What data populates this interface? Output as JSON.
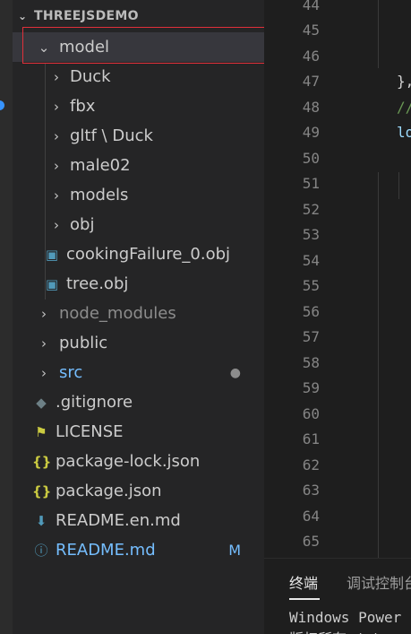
{
  "explorer": {
    "section_title": "THREEJSDEMO",
    "items": [
      {
        "label": "model",
        "kind": "folder",
        "expanded": true,
        "depth": 0
      },
      {
        "label": "Duck",
        "kind": "folder",
        "depth": 1
      },
      {
        "label": "fbx",
        "kind": "folder",
        "depth": 1
      },
      {
        "label": "gltf \\ Duck",
        "kind": "folder",
        "depth": 1
      },
      {
        "label": "male02",
        "kind": "folder",
        "depth": 1
      },
      {
        "label": "models",
        "kind": "folder",
        "depth": 1
      },
      {
        "label": "obj",
        "kind": "folder",
        "depth": 1
      },
      {
        "label": "cookingFailure_0.obj",
        "kind": "file",
        "icon": "obj-file-icon",
        "depth": 1
      },
      {
        "label": "tree.obj",
        "kind": "file",
        "icon": "obj-file-icon",
        "depth": 1
      },
      {
        "label": "node_modules",
        "kind": "folder",
        "depth": 0,
        "dimmed": true
      },
      {
        "label": "public",
        "kind": "folder",
        "depth": 0
      },
      {
        "label": "src",
        "kind": "folder",
        "depth": 0,
        "modified_dot": true
      },
      {
        "label": ".gitignore",
        "kind": "file",
        "icon": "git-icon",
        "depth": 0
      },
      {
        "label": "LICENSE",
        "kind": "file",
        "icon": "license-icon",
        "depth": 0
      },
      {
        "label": "package-lock.json",
        "kind": "file",
        "icon": "json-icon",
        "depth": 0
      },
      {
        "label": "package.json",
        "kind": "file",
        "icon": "json-icon",
        "depth": 0
      },
      {
        "label": "README.en.md",
        "kind": "file",
        "icon": "markdown-icon",
        "depth": 0
      },
      {
        "label": "README.md",
        "kind": "file",
        "icon": "info-icon",
        "depth": 0,
        "badge": "M"
      }
    ]
  },
  "editor": {
    "line_numbers": [
      "44",
      "45",
      "46",
      "47",
      "48",
      "49",
      "50",
      "51",
      "52",
      "53",
      "54",
      "55",
      "56",
      "57",
      "58",
      "59",
      "60",
      "61",
      "62",
      "63",
      "64",
      "65"
    ],
    "code_fragments": [
      {
        "line": "47",
        "text": "},"
      },
      {
        "line": "48",
        "text": "//"
      },
      {
        "line": "49",
        "text": "lo"
      }
    ]
  },
  "panel": {
    "tabs": [
      "终端",
      "调试控制台"
    ],
    "terminal_lines": [
      "Windows Power",
      "版权所有 (c)"
    ]
  },
  "colors": {
    "folder_text": "#cccccc",
    "src_text": "#75beff",
    "readme_text": "#75beff",
    "dimmed_text": "#8c8c8c",
    "badge": "#75beff",
    "highlight": "#e0303a",
    "json_icon": "#cbcb41",
    "obj_icon": "#519aba",
    "license_icon": "#cbcb41",
    "markdown_icon": "#519aba",
    "git_icon": "#6d8086"
  }
}
